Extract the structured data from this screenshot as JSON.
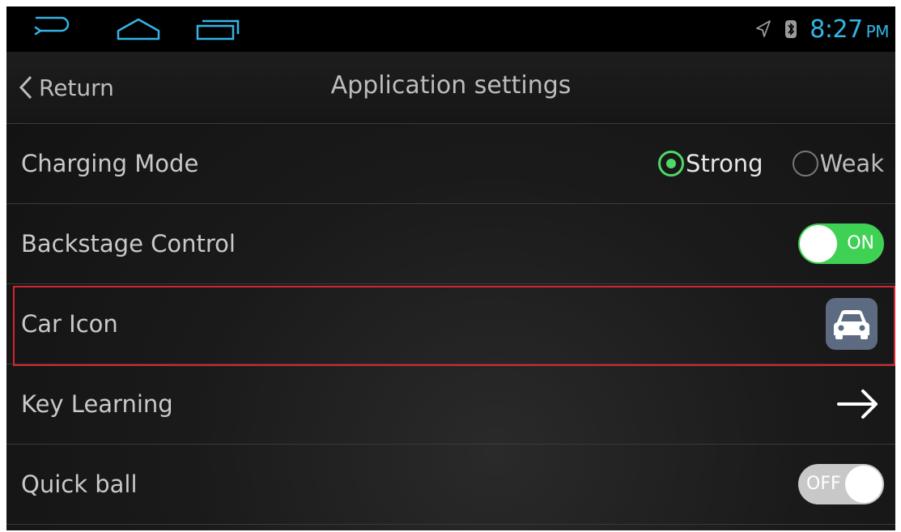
{
  "status_bar": {
    "time": "8:27",
    "ampm": "PM",
    "icons": [
      "back-icon",
      "home-icon",
      "recent-apps-icon",
      "location-icon",
      "bluetooth-icon"
    ],
    "clock_color": "#33b5e5"
  },
  "header": {
    "back_label": "Return",
    "title": "Application settings"
  },
  "settings": {
    "charging_mode": {
      "label": "Charging Mode",
      "options": [
        "Strong",
        "Weak"
      ],
      "selected": "Strong"
    },
    "backstage_control": {
      "label": "Backstage Control",
      "state": "ON"
    },
    "car_icon": {
      "label": "Car Icon",
      "icon": "car-icon"
    },
    "key_learning": {
      "label": "Key Learning",
      "icon": "arrow-right-icon"
    },
    "quick_ball": {
      "label": "Quick ball",
      "state": "OFF"
    }
  },
  "colors": {
    "accent_green": "#4cd964",
    "highlight_red": "#d3262d",
    "car_icon_bg": "#5d6b82"
  }
}
